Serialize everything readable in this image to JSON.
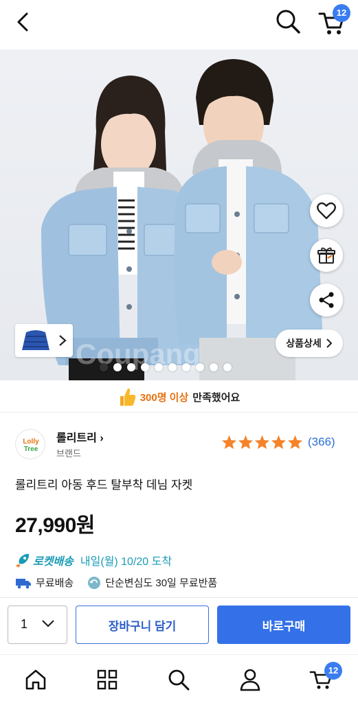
{
  "header": {
    "cart_badge": "12"
  },
  "hero": {
    "watermark": "Coupang",
    "detail_button_label": "상품상세",
    "total_images": 10,
    "active_image": 1
  },
  "social_proof": {
    "highlight": "300명 이상",
    "rest": "만족했어요"
  },
  "brand": {
    "logo_text": "Lolly Tree",
    "name": "롤리트리",
    "sub": "브랜드"
  },
  "rating": {
    "stars": 5,
    "count": "(366)",
    "star_color": "#f5832a"
  },
  "product": {
    "title": "롤리트리 아동 후드 탈부착 데님 자켓",
    "price": "27,990원"
  },
  "delivery": {
    "rocket_label": "로켓배송",
    "date": "내일(월) 10/20 도착",
    "free_shipping": "무료배송",
    "free_return": "단순변심도 30일 무료반품"
  },
  "buy_bar": {
    "quantity": "1",
    "cart_button": "장바구니 담기",
    "buy_button": "바로구매"
  },
  "bottom_nav": {
    "items": [
      {
        "icon": "home-icon"
      },
      {
        "icon": "categories-icon"
      },
      {
        "icon": "search-icon"
      },
      {
        "icon": "profile-icon"
      },
      {
        "icon": "cart-icon"
      }
    ],
    "cart_badge": "12"
  },
  "colors": {
    "accent_blue": "#3471e8",
    "rocket_teal": "#1a9bb7",
    "highlight_orange": "#e8700e"
  }
}
